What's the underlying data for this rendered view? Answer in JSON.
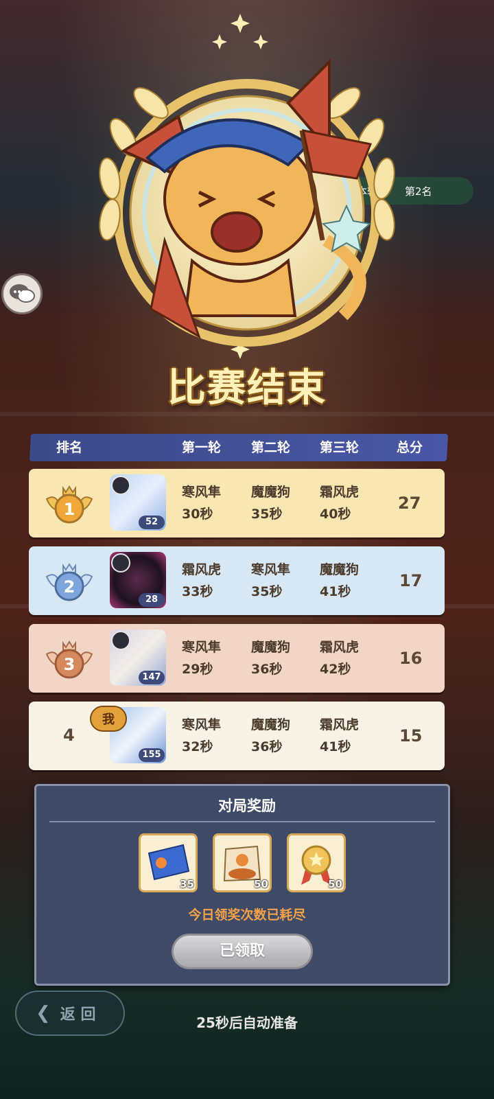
{
  "background": {
    "round_pill": {
      "label": "本轮",
      "rank": "第2名"
    }
  },
  "title": "比赛结束",
  "table": {
    "headers": {
      "rank": "排名",
      "round1": "第一轮",
      "round2": "第二轮",
      "round3": "第三轮",
      "total": "总分"
    },
    "rows": [
      {
        "rank": "1",
        "level": "52",
        "r1_name": "寒风隼",
        "r1_time": "30秒",
        "r2_name": "魔魔狗",
        "r2_time": "35秒",
        "r3_name": "霜风虎",
        "r3_time": "40秒",
        "total": "27"
      },
      {
        "rank": "2",
        "level": "28",
        "r1_name": "霜风虎",
        "r1_time": "33秒",
        "r2_name": "寒风隼",
        "r2_time": "35秒",
        "r3_name": "魔魔狗",
        "r3_time": "41秒",
        "total": "17"
      },
      {
        "rank": "3",
        "level": "147",
        "r1_name": "寒风隼",
        "r1_time": "29秒",
        "r2_name": "魔魔狗",
        "r2_time": "36秒",
        "r3_name": "霜风虎",
        "r3_time": "42秒",
        "total": "16"
      },
      {
        "rank": "4",
        "level": "155",
        "me_label": "我",
        "r1_name": "寒风隼",
        "r1_time": "32秒",
        "r2_name": "魔魔狗",
        "r2_time": "36秒",
        "r3_name": "霜风虎",
        "r3_time": "41秒",
        "total": "15"
      }
    ]
  },
  "rewards": {
    "title": "对局奖励",
    "items": [
      {
        "icon": "ticket-icon",
        "count": "35"
      },
      {
        "icon": "food-bag-icon",
        "count": "50"
      },
      {
        "icon": "medal-icon",
        "count": "50"
      }
    ],
    "notice": "今日领奖次数已耗尽",
    "button_label": "已领取"
  },
  "back_label": "返 回",
  "auto_ready": "25秒后自动准备",
  "colors": {
    "gold": "#f8e7b2",
    "silver": "#d7e7f4",
    "bronze": "#f1d6c8",
    "header": "#4a57a6",
    "accent": "#f2a24a"
  }
}
